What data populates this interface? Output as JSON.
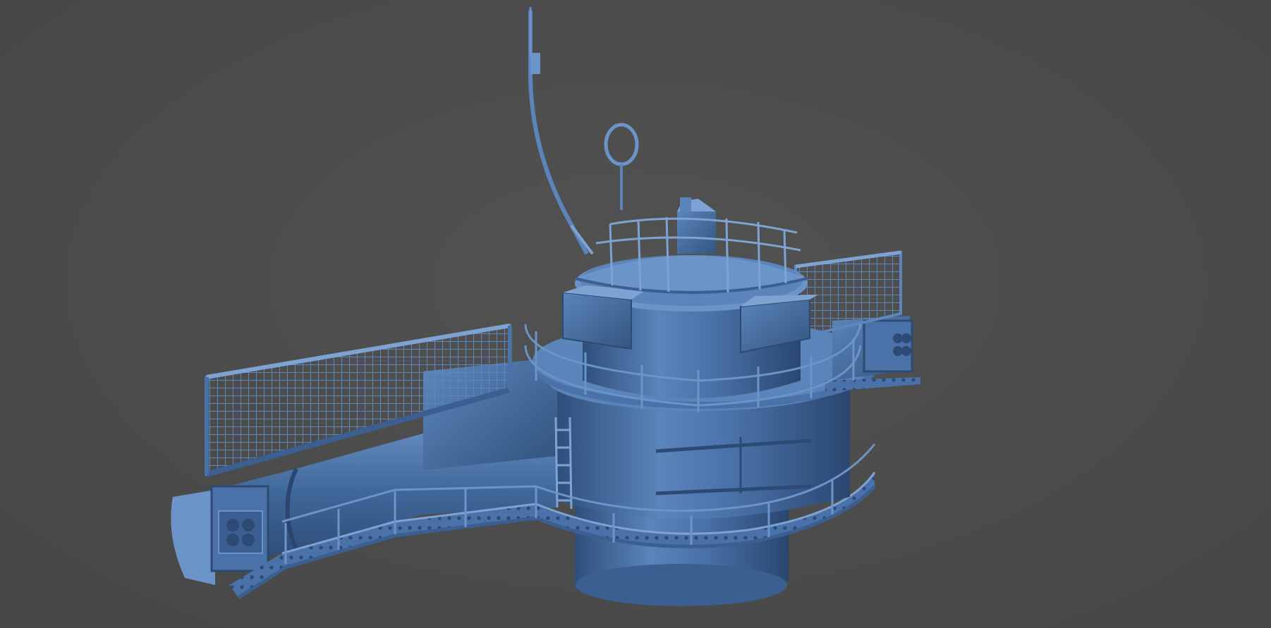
{
  "scene": {
    "background_color": "#4d4d4d",
    "model_base_color": "#4a72a8",
    "model_shadow_color": "#2c4a74",
    "model_highlight_color": "#7ea3d2",
    "subject": "radar-mast-structure"
  }
}
